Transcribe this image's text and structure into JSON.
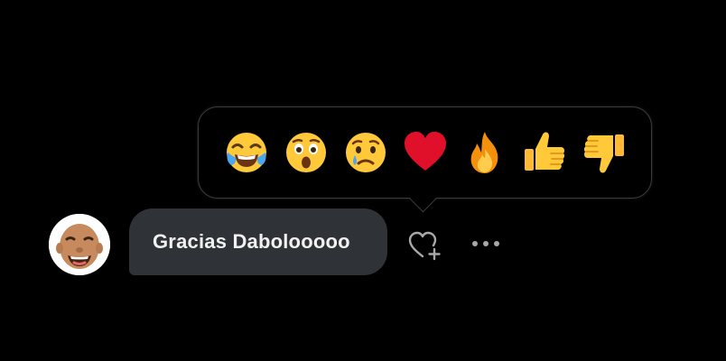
{
  "reaction_picker": {
    "reactions": [
      {
        "name": "tears-of-joy",
        "glyph": "😂"
      },
      {
        "name": "astonished",
        "glyph": "😲"
      },
      {
        "name": "crying",
        "glyph": "😢"
      },
      {
        "name": "red-heart",
        "glyph": "❤️"
      },
      {
        "name": "fire",
        "glyph": "🔥"
      },
      {
        "name": "thumbs-up",
        "glyph": "👍"
      },
      {
        "name": "thumbs-down",
        "glyph": "👎"
      }
    ]
  },
  "message": {
    "text": "Gracias Dabolooooo",
    "avatar": "bald-laughing-man-avatar"
  },
  "actions": {
    "react_icon": "heart-plus-icon",
    "more_icon": "more-horizontal-icon"
  },
  "colors": {
    "background": "#000000",
    "bubble": "#2f3236",
    "text": "#f1f1f1",
    "icon": "#a8a8a8",
    "heart": "#e0102b",
    "emoji_yellow": "#ffcc33"
  }
}
